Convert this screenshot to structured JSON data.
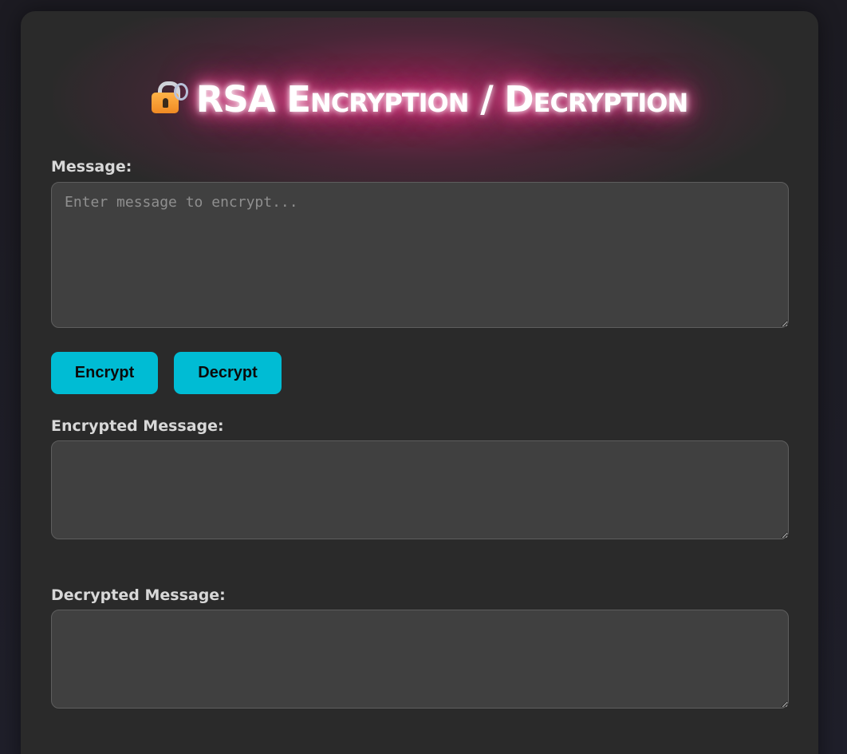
{
  "header": {
    "title": "RSA Encryption / Decryption",
    "icon": "lock-with-key-icon"
  },
  "message": {
    "label": "Message:",
    "placeholder": "Enter message to encrypt...",
    "value": ""
  },
  "actions": {
    "encrypt_label": "Encrypt",
    "decrypt_label": "Decrypt"
  },
  "encrypted": {
    "label": "Encrypted Message:",
    "value": ""
  },
  "decrypted": {
    "label": "Decrypted Message:",
    "value": ""
  },
  "colors": {
    "accent": "#00bcd4",
    "title_glow": "#ff3c8e",
    "card_background": "#2a2a2a",
    "field_background": "#404040"
  }
}
